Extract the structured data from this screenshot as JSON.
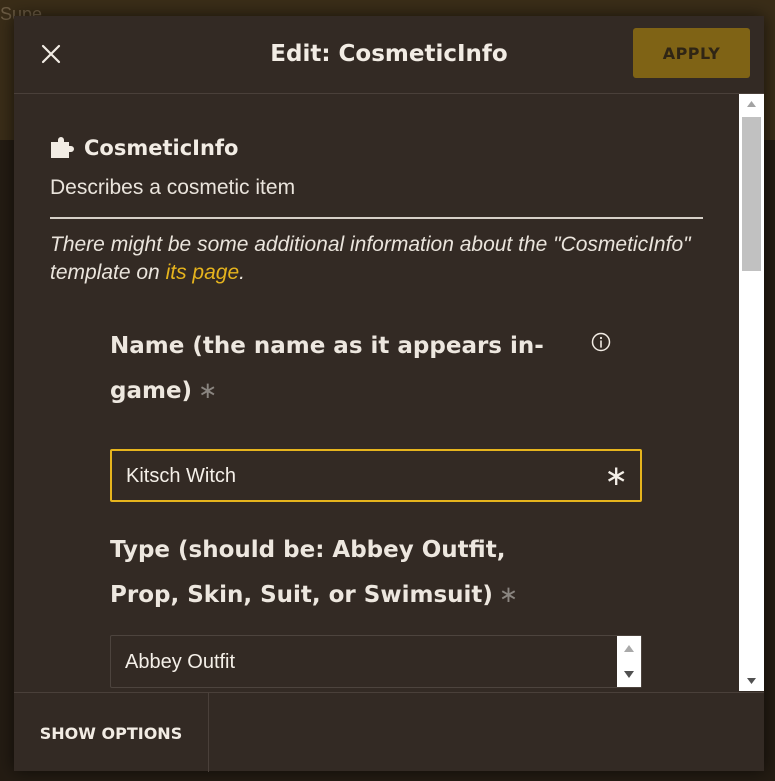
{
  "background": {
    "partial_text": "Supe"
  },
  "dialog": {
    "title": "Edit: CosmeticInfo",
    "apply_label": "APPLY",
    "close_icon": "close-icon",
    "accent_color": "#e6b41d"
  },
  "template": {
    "icon": "puzzle-piece-icon",
    "name": "CosmeticInfo",
    "description": "Describes a cosmetic item",
    "note_prefix": "There might be some additional information about the \"CosmeticInfo\" template on ",
    "note_link": "its page",
    "note_suffix": "."
  },
  "params": [
    {
      "label": "Name (the name as it appears in-game)",
      "required_mark": "∗",
      "info_icon": "info-icon",
      "value": "Kitsch Witch",
      "field_mark": "∗"
    },
    {
      "label": "Type (should be: Abbey Outfit, Prop, Skin, Suit, or Swimsuit)",
      "required_mark": "∗",
      "value": "Abbey Outfit"
    }
  ],
  "footer": {
    "show_options_label": "SHOW OPTIONS"
  }
}
